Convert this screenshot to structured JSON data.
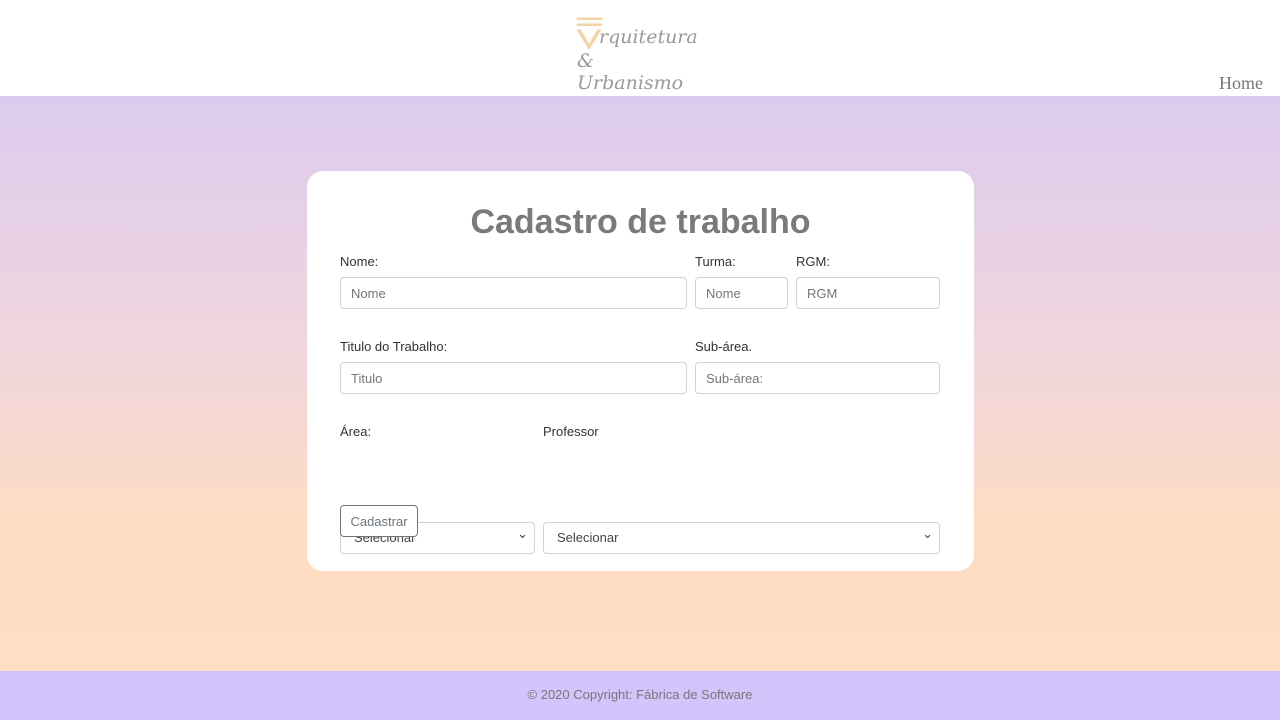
{
  "header": {
    "logo_text": "Arquitetura & Urbanismo",
    "logo_line1": "rquitetura",
    "logo_line2": "& Urbanismo",
    "nav_home": "Home"
  },
  "form": {
    "title": "Cadastro de trabalho",
    "nome": {
      "label": "Nome:",
      "placeholder": "Nome"
    },
    "turma": {
      "label": "Turma:",
      "placeholder": "Nome"
    },
    "rgm": {
      "label": "RGM:",
      "placeholder": "RGM"
    },
    "titulo": {
      "label": "Titulo do Trabalho:",
      "placeholder": "Titulo"
    },
    "subarea": {
      "label": "Sub-área.",
      "placeholder": "Sub-área:"
    },
    "area": {
      "label": "Área:",
      "value": "Selecionar"
    },
    "professor": {
      "label": "Professor",
      "value": "Selecionar"
    },
    "submit": "Cadastrar"
  },
  "footer": {
    "text": "© 2020 Copyright: Fábrica de Software"
  }
}
